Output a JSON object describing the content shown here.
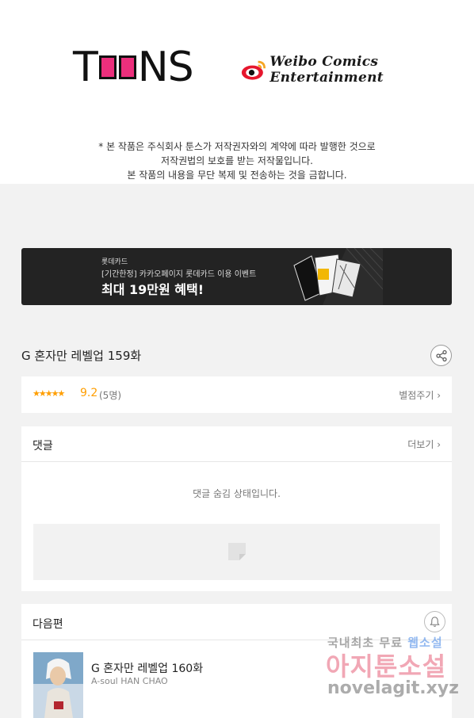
{
  "header": {
    "toons_logo_text": [
      "T",
      "NS"
    ],
    "weibo_logo_text": "Weibo Comics Entertainment",
    "notice_lines": [
      "* 본 작품은 주식회사 툰스가 저작권자와의 계약에 따라 발행한 것으로",
      "저작권법의 보호를 받는 저작물입니다.",
      "본 작품의 내용을 무단 복제 및 전송하는 것을 금합니다."
    ]
  },
  "banner": {
    "line1": "롯데카드",
    "line2": "[기간한정] 카카오페이지 롯데카드 이용 이벤트",
    "line3": "최대 19만원 혜택!",
    "bg_color": "#232323"
  },
  "episode": {
    "title": "G 혼자만 레벨업 159화",
    "share_icon": "share-icon"
  },
  "rating": {
    "stars": "★★★★★",
    "score": "9.2",
    "count": "(5명)",
    "rate_link": "별점주기 ›",
    "star_color": "#ff9e00"
  },
  "comments": {
    "title": "댓글",
    "more_link": "더보기 ›",
    "hidden_message": "댓글 숨김 상태입니다."
  },
  "next_episode": {
    "section_title": "다음편",
    "title": "G 혼자만 레벨업 160화",
    "author": "A-soul HAN CHAO",
    "bell_icon": "bell-icon"
  },
  "watermark": {
    "line1_a": "국내최초 무료 ",
    "line1_b": "웹소설",
    "line2": "아지툰소설",
    "line3": "novelagit.xyz"
  }
}
